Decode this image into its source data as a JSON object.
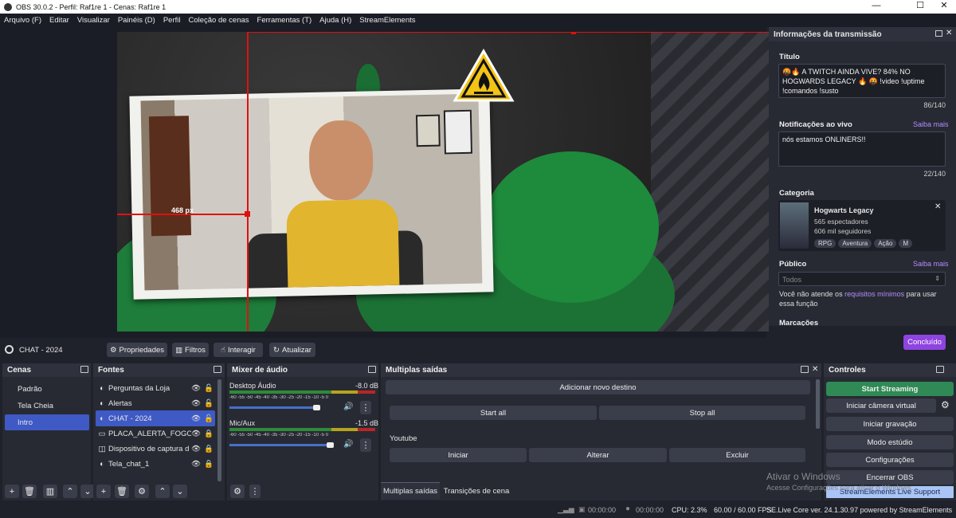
{
  "window": {
    "title": "OBS 30.0.2 - Perfil: Raf1re 1 - Cenas: Raf1re 1",
    "minimize": "—",
    "maximize": "☐",
    "close": "✕"
  },
  "menu": [
    "Arquivo (F)",
    "Editar",
    "Visualizar",
    "Painéis (D)",
    "Perfil",
    "Coleção de cenas",
    "Ferramentas (T)",
    "Ajuda (H)",
    "StreamElements"
  ],
  "preview": {
    "measure_label": "468 px"
  },
  "scene_toolbar": {
    "current_source": "CHAT - 2024",
    "properties": "Propriedades",
    "filters": "Filtros",
    "interact": "Interagir",
    "refresh": "Atualizar"
  },
  "stream_info": {
    "header": "Informações da transmissão",
    "title_label": "Título",
    "title_value": "🤬🔥 A TWITCH AINDA VIVE? 84% NO HOGWARDS LEGACY 🔥 🤬 !video !uptime !comandos !susto",
    "title_count": "86/140",
    "notif_label": "Notificações ao vivo",
    "learn_more": "Saiba mais",
    "notif_value": "nós estamos ONLINERS!!",
    "notif_count": "22/140",
    "category_label": "Categoria",
    "game_name": "Hogwarts Legacy",
    "viewers": "565 espectadores",
    "followers": "606 mil seguidores",
    "tags": [
      "RPG",
      "Aventura",
      "Ação",
      "M"
    ],
    "audience_label": "Público",
    "audience_value": "Todos",
    "audience_note_1": "Você não atende os",
    "audience_note_link": "requisitos mínimos",
    "audience_note_2": "para usar essa função",
    "markers_label": "Marcações",
    "done": "Concluído"
  },
  "docks": {
    "scenes": {
      "title": "Cenas",
      "items": [
        "Padrão",
        "Tela Cheia",
        "Intro"
      ],
      "selected": 2
    },
    "sources": {
      "title": "Fontes",
      "items": [
        "Perguntas da Loja",
        "Alertas",
        "CHAT - 2024",
        "PLACA_ALERTA_FOGO",
        "Dispositivo de captura d",
        "Tela_chat_1"
      ],
      "selected": 2
    },
    "mixer": {
      "title": "Mixer de áudio",
      "channels": [
        {
          "name": "Desktop Áudio",
          "db": "-8.0 dB",
          "level": 0.78
        },
        {
          "name": "Mic/Aux",
          "db": "-1.5 dB",
          "level": 0.9
        }
      ],
      "scale": "-60 -55 -50 -45 -40 -35 -30 -25 -20 -15 -10 -5 0"
    },
    "outputs": {
      "title": "Multiplas saídas",
      "add_destination": "Adicionar novo destino",
      "start_all": "Start all",
      "stop_all": "Stop all",
      "destination": "Youtube",
      "start": "Iniciar",
      "edit": "Alterar",
      "delete": "Excluir",
      "tab_outputs": "Multiplas saídas",
      "tab_transitions": "Transições de cena"
    },
    "controls": {
      "title": "Controles",
      "start_streaming": "Start Streaming",
      "virtual_cam": "Iniciar câmera virtual",
      "start_recording": "Iniciar gravação",
      "studio_mode": "Modo estúdio",
      "settings": "Configurações",
      "exit": "Encerrar OBS",
      "se_support": "StreamElements Live Support"
    }
  },
  "watermark": {
    "line1": "Ativar o Windows",
    "line2": "Acesse Configurações para ativar o Windows."
  },
  "status": {
    "rec_time": "00:00:00",
    "stream_time": "00:00:00",
    "cpu": "CPU: 2.3%",
    "fps": "60.00 / 60.00 FPS",
    "se_version": "SE.Live Core ver. 24.1.30.97 powered by StreamElements"
  },
  "colors": {
    "accent": "#3f59c5",
    "done_btn": "#8e44e0",
    "start_stream": "#2f8a55",
    "se_support": "#a9c4f5",
    "guide": "#e01010"
  }
}
